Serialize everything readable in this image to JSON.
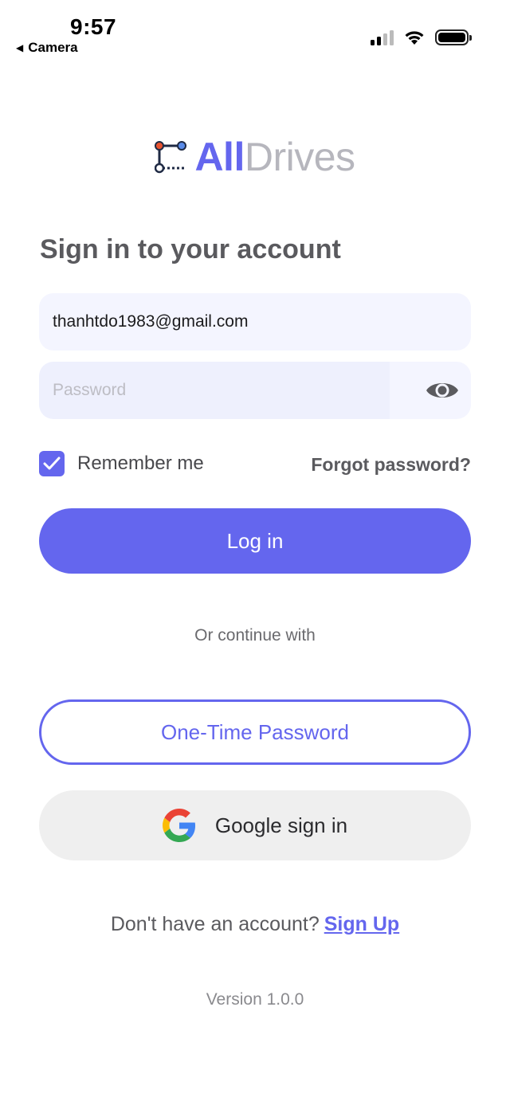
{
  "status_bar": {
    "time": "9:57",
    "back_label": "Camera",
    "back_icon": "back-triangle-icon",
    "signal_icon": "cellular-signal-icon",
    "wifi_icon": "wifi-icon",
    "battery_icon": "battery-icon"
  },
  "logo": {
    "icon": "drives-logo-icon",
    "part1": "All",
    "part2": "Drives"
  },
  "heading": "Sign in to your account",
  "form": {
    "email_value": "thanhtdo1983@gmail.com",
    "password_value": "",
    "password_placeholder": "Password",
    "show_password_icon": "eye-icon",
    "remember_label": "Remember me",
    "remember_checked": true,
    "forgot_label": "Forgot password?",
    "login_label": "Log in"
  },
  "alternatives": {
    "or_text": "Or continue with",
    "otp_label": "One-Time Password",
    "google_label": "Google sign in",
    "google_icon": "google-g-icon"
  },
  "signup": {
    "prompt": "Don't have an account?",
    "link_label": "Sign Up"
  },
  "version": "Version 1.0.0",
  "colors": {
    "accent": "#6466ee",
    "field_bg": "#f4f5ff",
    "google_btn_bg": "#efefef"
  }
}
